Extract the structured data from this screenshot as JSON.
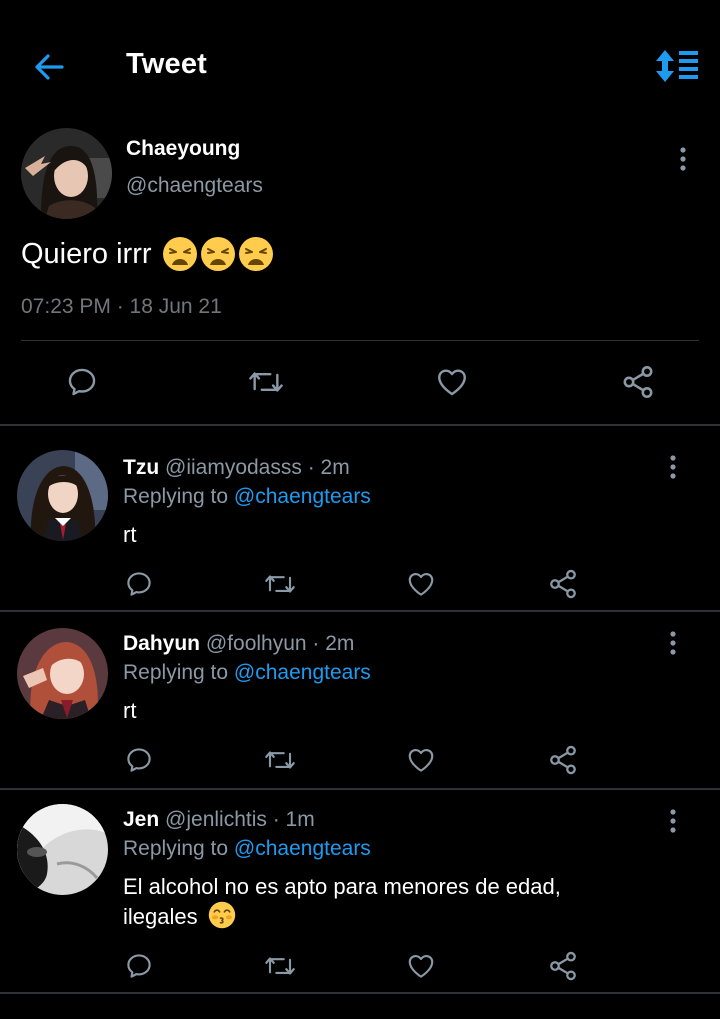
{
  "header": {
    "title": "Tweet",
    "back_icon": "arrow-left-icon",
    "sort_icon": "sort-order-icon",
    "accent_color": "#1d9bf0"
  },
  "tweet": {
    "name": "Chaeyoung",
    "handle": "@chaengtears",
    "text": "Quiero irrr",
    "emojis": [
      "😩",
      "😩",
      "😩"
    ],
    "timestamp": "07:23 PM · 18 Jun 21",
    "actions": [
      "reply-icon",
      "retweet-icon",
      "like-icon",
      "share-icon"
    ]
  },
  "replies": [
    {
      "name": "Tzu",
      "meta": "@iiamyodasss · 2m",
      "replying_prefix": "Replying to",
      "replying_to": "@chaengtears",
      "text": "rt",
      "emoji": ""
    },
    {
      "name": "Dahyun",
      "meta": "@foolhyun · 2m",
      "replying_prefix": "Replying to",
      "replying_to": "@chaengtears",
      "text": "rt",
      "emoji": ""
    },
    {
      "name": "Jen",
      "meta": "@jenlichtis · 1m",
      "replying_prefix": "Replying to",
      "replying_to": "@chaengtears",
      "text": "El alcohol no es apto para menores de edad, ilegales",
      "emoji": "😚"
    }
  ]
}
